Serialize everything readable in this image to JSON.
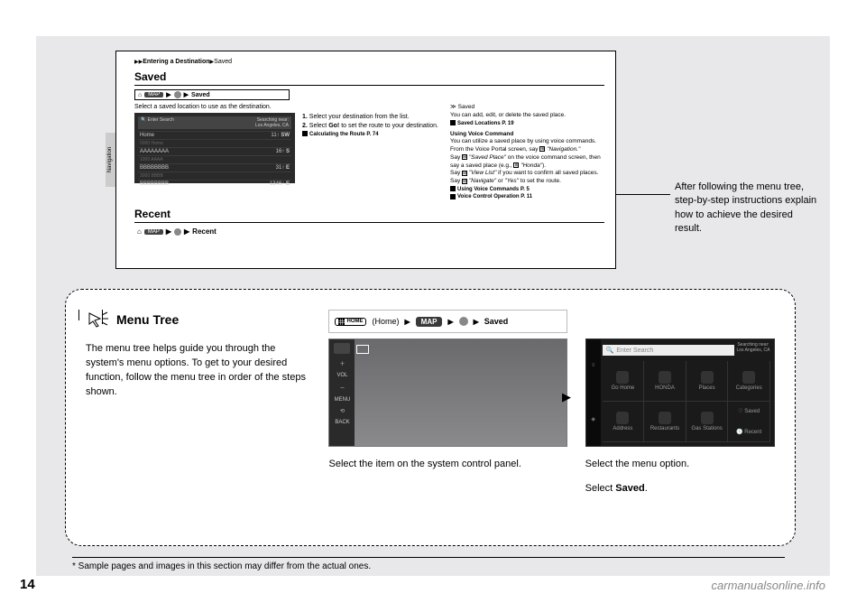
{
  "page_number": "14",
  "watermark": "carmanualsonline.info",
  "manual_excerpt": {
    "breadcrumb_a": "Entering a Destination",
    "breadcrumb_b": "Saved",
    "title_saved": "Saved",
    "tree_map": "MAP",
    "tree_end": "Saved",
    "instruction": "Select a saved location to use as the destination.",
    "side_tab": "Navigation",
    "screenshot": {
      "search_placeholder": "Enter Search",
      "near_label": "Searching near:",
      "near_value": "Los Angeles, CA",
      "rows": [
        {
          "name": "Home",
          "sub": "0000 Home",
          "dist": "11",
          "dir": "SW"
        },
        {
          "name": "AAAAAAAA",
          "sub": "1000 AAAA",
          "dist": "16",
          "dir": "S"
        },
        {
          "name": "BBBBBBBB",
          "sub": "3000 BBBB",
          "dist": "31",
          "dir": "E"
        },
        {
          "name": "BBBBBBBB",
          "sub": "",
          "dist": "1346",
          "dir": "E"
        }
      ]
    },
    "steps": {
      "s1_pre": "1.",
      "s1": "Select your destination from the list.",
      "s2_pre": "2.",
      "s2a": "Select ",
      "s2_go": "Go!",
      "s2b": " to set the route to your destination.",
      "ref_calc": "Calculating the Route",
      "ref_calc_p": "P. 74"
    },
    "notes": {
      "head": "Saved",
      "l1": "You can add, edit, or delete the saved place.",
      "ref1": "Saved Locations",
      "ref1_p": "P. 19",
      "head2": "Using Voice Command",
      "l2": "You can utilize a saved place by using voice commands.",
      "l3a": "From the Voice Portal screen, say ",
      "l3b": "\"Navigation.\"",
      "l4a": "Say ",
      "l4b": "\"Saved Place\"",
      "l4c": " on the voice command screen, then say a saved place (e.g., ",
      "l4d": "\"Honda\"",
      "l4e": ").",
      "l5a": "Say ",
      "l5b": "\"View List\"",
      "l5c": " if you want to confirm all saved places.",
      "l6a": "Say ",
      "l6b": "\"Navigate\"",
      "l6c": " or ",
      "l6d": "\"Yes\"",
      "l6e": " to set the route.",
      "ref2": "Using Voice Commands",
      "ref2_p": "P. 5",
      "ref3": "Voice Control Operation",
      "ref3_p": "P. 11"
    },
    "title_recent": "Recent",
    "tree_end_recent": "Recent"
  },
  "callout": "After following the menu tree, step-by-step instructions explain how to achieve the desired result.",
  "menu_tree": {
    "title": "Menu Tree",
    "body": "The menu tree helps guide you through the system's menu options. To get to your desired function, follow the menu tree in order of the steps shown.",
    "bar": {
      "home_label": "HOME",
      "home_paren": "(Home)",
      "map": "MAP",
      "saved": "Saved"
    },
    "panel_caption": "Select the item on the system control panel.",
    "panel_side": {
      "vol": "VOL",
      "menu": "MENU",
      "back": "BACK"
    },
    "map_caption1": "Select the menu option.",
    "map_caption2a": "Select ",
    "map_caption2b": "Saved",
    "map_caption2c": ".",
    "map_search": "Enter Search",
    "map_near1": "Searching near:",
    "map_near2": "Los Angeles, CA",
    "map_cells": [
      "Go Home",
      "HONDA",
      "Places",
      "Categories",
      "Address",
      "Restaurants",
      "Gas Stations",
      "Saved",
      "Recent"
    ]
  },
  "footnote": "* Sample pages and images in this section may differ from the actual ones."
}
